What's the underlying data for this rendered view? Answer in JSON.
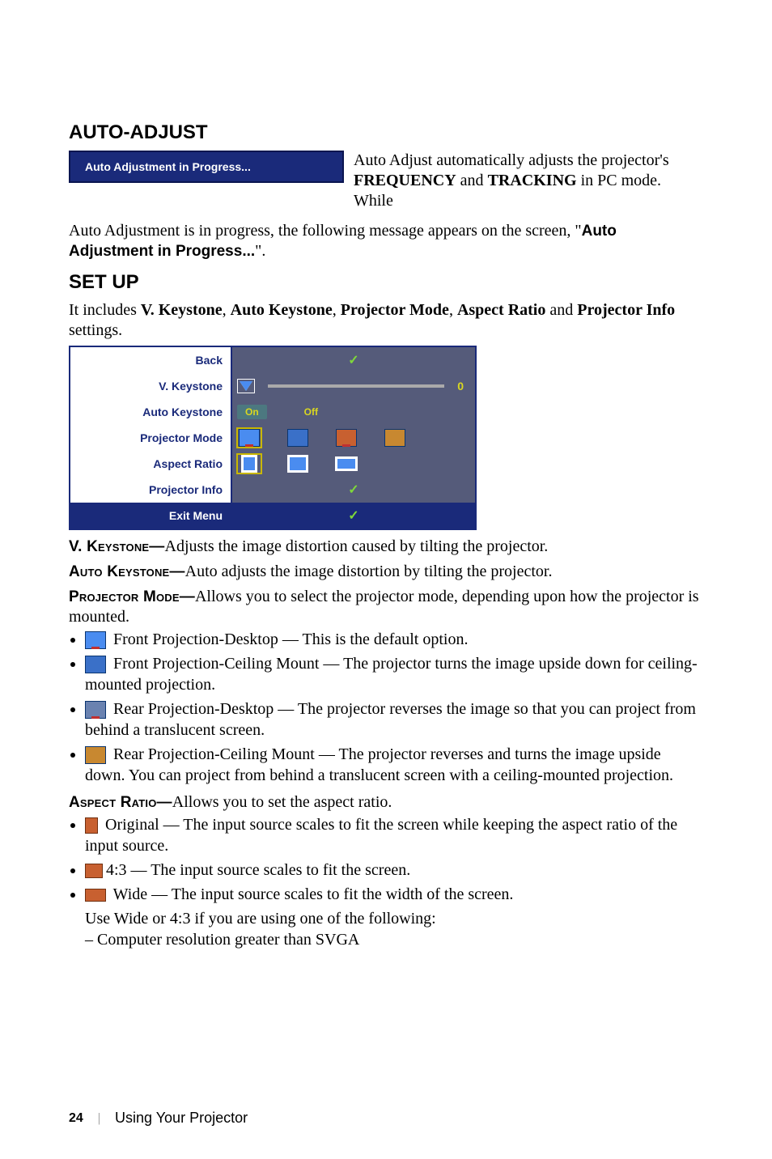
{
  "sections": {
    "auto_adjust": {
      "heading": "AUTO-ADJUST",
      "progress_box": "Auto Adjustment in Progress...",
      "para_lead": "Auto Adjust automatically adjusts the projector's ",
      "para_freq": "FREQUENCY",
      "para_and": " and ",
      "para_track": "TRACKING",
      "para_tail": " in PC mode. While ",
      "para_cont": "Auto Adjustment is in progress, the following message appears on the screen, \"",
      "para_msg": "Auto Adjustment in Progress...",
      "para_end": "\"."
    },
    "setup": {
      "heading": "SET UP",
      "intro_pre": "It includes ",
      "intro_items": [
        "V. Keystone",
        "Auto Keystone",
        "Projector Mode",
        "Aspect Ratio"
      ],
      "intro_and": " and ",
      "intro_last": "Projector Info",
      "intro_tail": " settings."
    }
  },
  "menu": {
    "rows": {
      "back": "Back",
      "vkeystone": "V. Keystone",
      "vkeystone_value": "0",
      "autokeystone": "Auto Keystone",
      "autokeystone_on": "On",
      "autokeystone_off": "Off",
      "projector_mode": "Projector Mode",
      "aspect_ratio": "Aspect Ratio",
      "projector_info": "Projector Info",
      "exit": "Exit Menu"
    }
  },
  "defs": {
    "vkeystone": {
      "label": "V. Keystone—",
      "text": "Adjusts the image distortion caused by tilting the projector."
    },
    "autokeystone": {
      "label": "Auto Keystone—",
      "text": "Auto adjusts the image distortion by tilting the projector."
    },
    "projector_mode": {
      "label": "Projector Mode—",
      "text": "Allows you to select the projector mode, depending upon how the projector is mounted.",
      "items": [
        {
          "name": "Front Projection-Desktop — This is the default option."
        },
        {
          "name": "Front Projection-Ceiling Mount — The projector turns the image upside down for ceiling-mounted projection."
        },
        {
          "name": "Rear Projection-Desktop — The projector reverses the image so that you can project from behind a translucent screen."
        },
        {
          "name": "Rear Projection-Ceiling Mount — The projector reverses and turns the image upside down. You can project from behind a translucent screen with a ceiling-mounted projection."
        }
      ]
    },
    "aspect_ratio": {
      "label": "Aspect Ratio—",
      "text": "Allows you to set the aspect ratio.",
      "items": [
        {
          "name": "Original — The input source scales to fit the screen while keeping the aspect ratio of the input source."
        },
        {
          "name": "4:3 — The input source scales to fit the screen."
        },
        {
          "name": "Wide — The input source scales to fit the width of the screen."
        }
      ],
      "tail1": "Use Wide or 4:3 if you are using one of the following:",
      "tail2": "– Computer resolution greater than SVGA"
    }
  },
  "footer": {
    "page": "24",
    "label": "Using Your Projector"
  }
}
